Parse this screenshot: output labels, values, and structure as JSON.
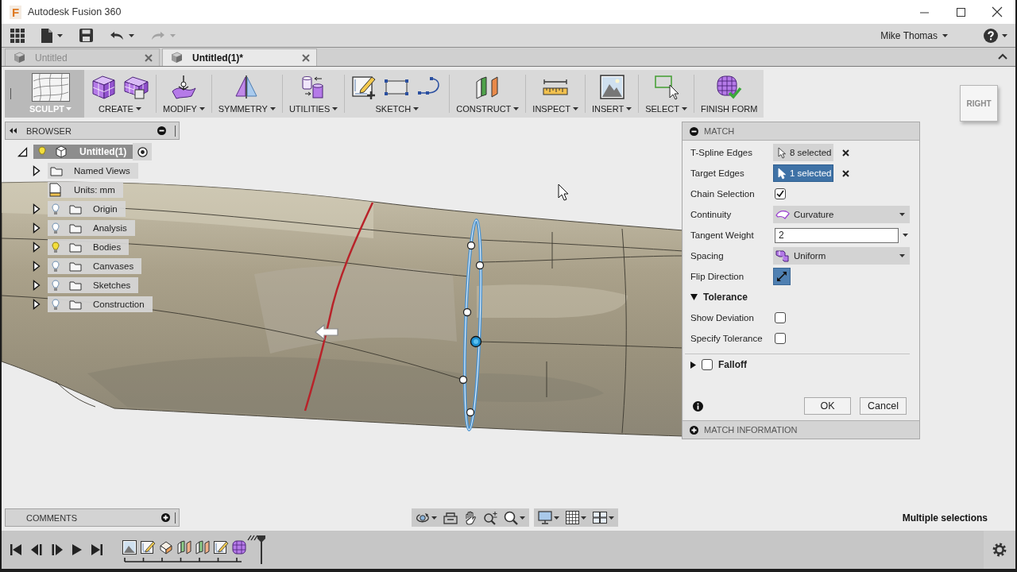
{
  "window": {
    "logo": "F",
    "title": "Autodesk Fusion 360"
  },
  "quick_access": {
    "buttons": [
      {
        "kind": "apps",
        "menu": false,
        "disabled": false
      },
      {
        "kind": "file",
        "menu": true,
        "disabled": false
      },
      {
        "kind": "save",
        "menu": false,
        "disabled": false
      },
      {
        "kind": "undo",
        "menu": true,
        "disabled": false
      },
      {
        "kind": "redo",
        "menu": true,
        "disabled": true
      }
    ],
    "user": "Mike Thomas"
  },
  "document_tabs": [
    {
      "label": "Untitled",
      "selected": false
    },
    {
      "label": "Untitled(1)*",
      "selected": true
    }
  ],
  "toolbar": {
    "workspace": {
      "label": "SCULPT",
      "menu": true
    },
    "groups": [
      {
        "label": "CREATE",
        "kind": "create",
        "menu": true
      },
      {
        "label": "MODIFY",
        "kind": "modify",
        "menu": true
      },
      {
        "label": "SYMMETRY",
        "kind": "symmetry",
        "menu": true
      },
      {
        "label": "UTILITIES",
        "kind": "utilities",
        "menu": true
      },
      {
        "label": "SKETCH",
        "kind": "sketch",
        "menu": true
      },
      {
        "label": "CONSTRUCT",
        "kind": "construct",
        "menu": true
      },
      {
        "label": "INSPECT",
        "kind": "inspect",
        "menu": true
      },
      {
        "label": "INSERT",
        "kind": "insert",
        "menu": true
      },
      {
        "label": "SELECT",
        "kind": "select",
        "menu": true
      },
      {
        "label": "FINISH FORM",
        "kind": "finish",
        "menu": false
      }
    ]
  },
  "view_cube": {
    "face": "RIGHT"
  },
  "browser": {
    "title": "BROWSER",
    "expanded": true,
    "root": {
      "label": "Untitled(1)",
      "expanded": true,
      "visible": true,
      "active": true,
      "children": [
        {
          "label": "Named Views",
          "kind": "views",
          "expanded": false
        },
        {
          "label": "Units: mm",
          "kind": "units"
        },
        {
          "label": "Origin",
          "kind": "folder",
          "expanded": false,
          "visible": false
        },
        {
          "label": "Analysis",
          "kind": "folder",
          "expanded": false,
          "visible": false
        },
        {
          "label": "Bodies",
          "kind": "folder",
          "expanded": false,
          "visible": true
        },
        {
          "label": "Canvases",
          "kind": "folder",
          "expanded": false,
          "visible": false
        },
        {
          "label": "Sketches",
          "kind": "folder",
          "expanded": false,
          "visible": false
        },
        {
          "label": "Construction",
          "kind": "folder",
          "expanded": false,
          "visible": false
        }
      ]
    }
  },
  "dialog": {
    "title": "MATCH",
    "expanded": true,
    "rows": [
      {
        "kind": "selection",
        "label": "T-Spline Edges",
        "value": "8 selected",
        "selected": false
      },
      {
        "kind": "selection",
        "label": "Target Edges",
        "value": "1 selected",
        "selected": true
      },
      {
        "kind": "checkbox",
        "label": "Chain Selection",
        "checked": true
      },
      {
        "kind": "dropdown",
        "label": "Continuity",
        "value": "Curvature"
      },
      {
        "kind": "combo",
        "label": "Tangent Weight",
        "value": "2"
      },
      {
        "kind": "dropdown",
        "label": "Spacing",
        "value": "Uniform"
      },
      {
        "kind": "toggle",
        "label": "Flip Direction",
        "on": true
      },
      {
        "kind": "section",
        "label": "Tolerance",
        "expanded": true
      },
      {
        "kind": "checkbox",
        "label": "Show Deviation",
        "checked": false
      },
      {
        "kind": "checkbox",
        "label": "Specify Tolerance",
        "checked": false
      }
    ],
    "falloff": {
      "label": "Falloff",
      "expanded": false,
      "checked": false
    },
    "buttons": [
      "OK",
      "Cancel"
    ],
    "info": {
      "title": "MATCH INFORMATION",
      "expanded": false
    }
  },
  "comments": {
    "title": "COMMENTS",
    "expanded": false
  },
  "status": "Multiple selections"
}
